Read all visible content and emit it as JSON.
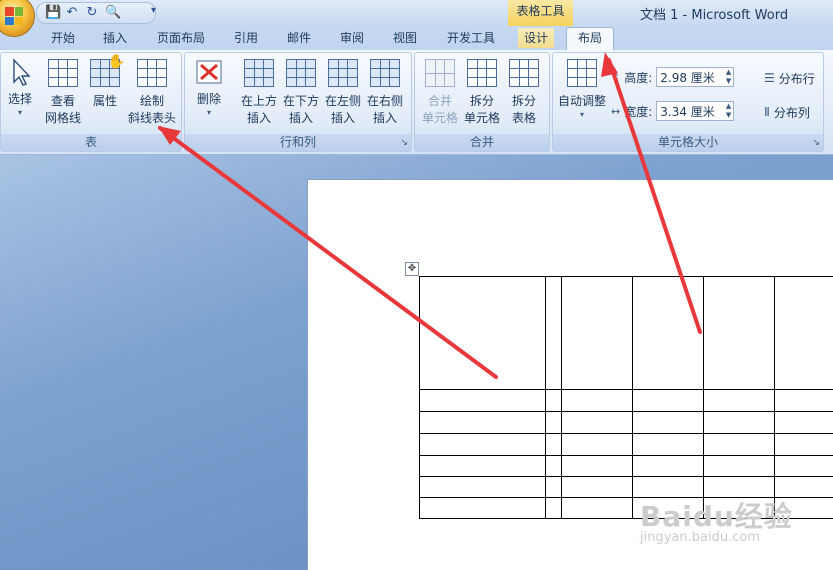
{
  "window": {
    "context_tab_label": "表格工具",
    "title": "文档 1 - Microsoft Word"
  },
  "quick_access": {
    "icons": [
      "save-icon",
      "undo-icon",
      "redo-icon",
      "print-preview-icon"
    ]
  },
  "tabs": [
    {
      "label": "开始"
    },
    {
      "label": "插入"
    },
    {
      "label": "页面布局"
    },
    {
      "label": "引用"
    },
    {
      "label": "邮件"
    },
    {
      "label": "审阅"
    },
    {
      "label": "视图"
    },
    {
      "label": "开发工具"
    },
    {
      "label": "设计"
    },
    {
      "label": "布局",
      "active": true
    }
  ],
  "ribbon": {
    "table_group": {
      "label": "表",
      "select": {
        "label": "选择"
      },
      "view_gridlines": {
        "line1": "查看",
        "line2": "网格线"
      },
      "properties": {
        "label": "属性"
      },
      "draw_diagonal": {
        "line1": "绘制",
        "line2": "斜线表头"
      }
    },
    "rows_cols_group": {
      "label": "行和列",
      "delete": {
        "label": "删除"
      },
      "insert_above": {
        "line1": "在上方",
        "line2": "插入"
      },
      "insert_below": {
        "line1": "在下方",
        "line2": "插入"
      },
      "insert_left": {
        "line1": "在左侧",
        "line2": "插入"
      },
      "insert_right": {
        "line1": "在右侧",
        "line2": "插入"
      }
    },
    "merge_group": {
      "label": "合并",
      "merge_cells": {
        "line1": "合并",
        "line2": "单元格"
      },
      "split_cells": {
        "line1": "拆分",
        "line2": "单元格"
      },
      "split_table": {
        "line1": "拆分",
        "line2": "表格"
      }
    },
    "cell_size_group": {
      "label": "单元格大小",
      "autofit": {
        "label": "自动调整"
      },
      "height": {
        "label": "高度:",
        "value": "2.98 厘米"
      },
      "width": {
        "label": "宽度:",
        "value": "3.34 厘米"
      },
      "distribute_rows": {
        "label": "分布行"
      },
      "distribute_cols": {
        "label": "分布列"
      }
    }
  },
  "watermark": {
    "text": "Baidu经验",
    "sub": "jingyan.baidu.com"
  },
  "colors": {
    "annotation_arrow": "#e8383b",
    "context_tab": "#f4d25c"
  }
}
